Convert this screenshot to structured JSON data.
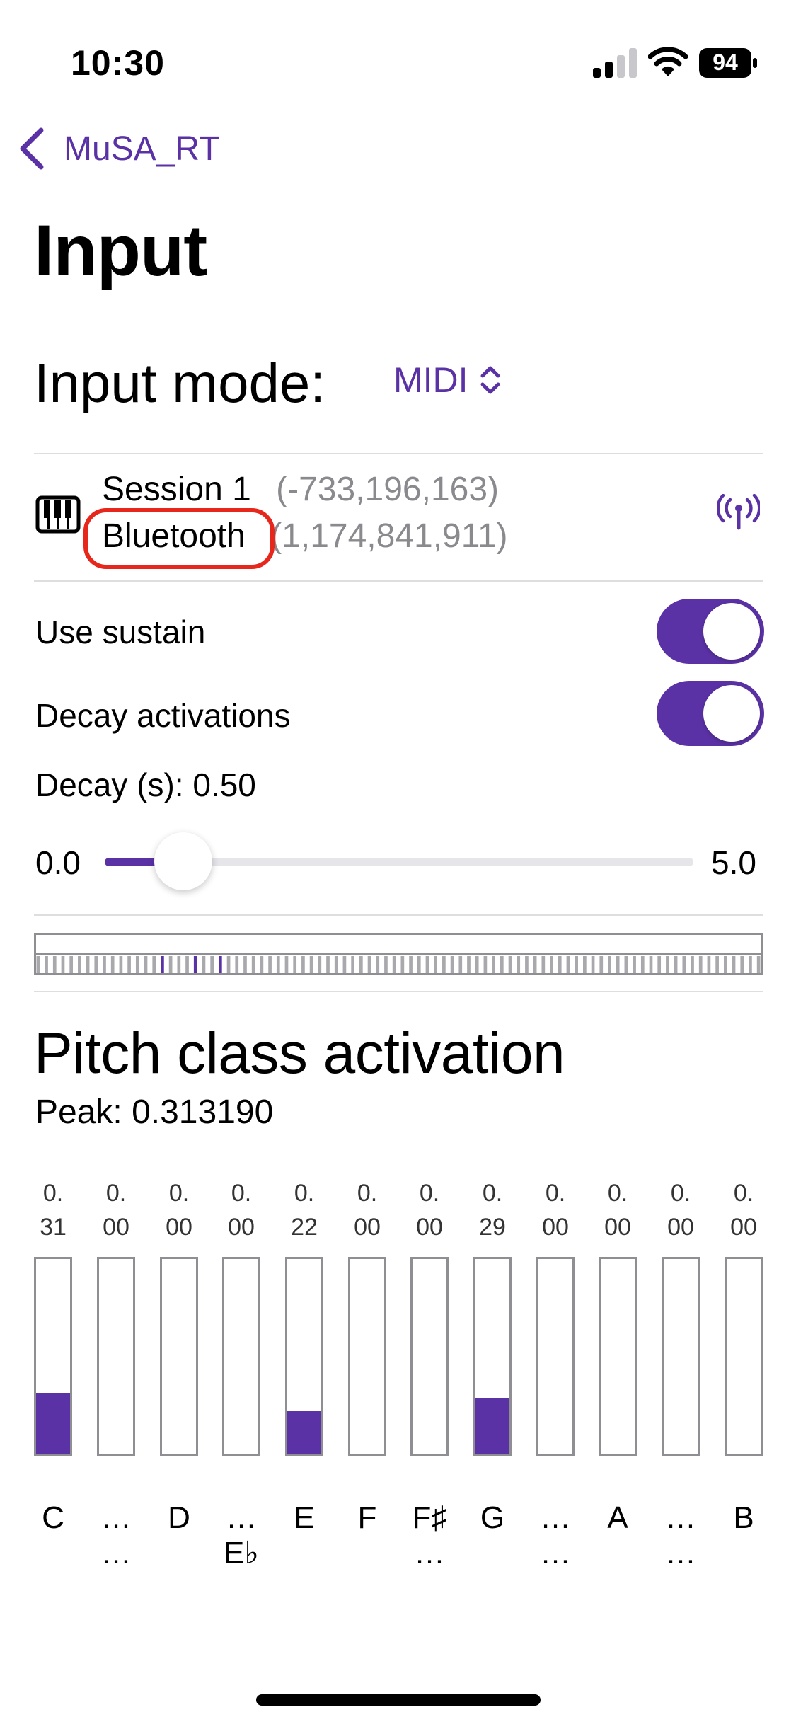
{
  "status_bar": {
    "time": "10:30",
    "battery": "94"
  },
  "nav": {
    "back_label": "MuSA_RT"
  },
  "page": {
    "title": "Input"
  },
  "input_mode": {
    "label": "Input mode:",
    "value": "MIDI"
  },
  "device": {
    "name": "Session 1",
    "name_id": "(-733,196,163)",
    "type": "Bluetooth",
    "type_id": "(1,174,841,911)"
  },
  "settings": {
    "use_sustain_label": "Use sustain",
    "use_sustain_on": true,
    "decay_activations_label": "Decay activations",
    "decay_activations_on": true,
    "decay_value_label": "Decay (s): 0.50",
    "decay_value": 0.5,
    "slider_min": "0.0",
    "slider_max": "5.0"
  },
  "pitch": {
    "title": "Pitch class activation",
    "peak_label": "Peak: 0.313190",
    "bars": [
      {
        "top": "0.",
        "bottom": "31",
        "value": 0.31,
        "note": "C",
        "note2": ""
      },
      {
        "top": "0.",
        "bottom": "00",
        "value": 0.0,
        "note": "…",
        "note2": "…"
      },
      {
        "top": "0.",
        "bottom": "00",
        "value": 0.0,
        "note": "D",
        "note2": ""
      },
      {
        "top": "0.",
        "bottom": "00",
        "value": 0.0,
        "note": "…",
        "note2": "E♭"
      },
      {
        "top": "0.",
        "bottom": "22",
        "value": 0.22,
        "note": "E",
        "note2": ""
      },
      {
        "top": "0.",
        "bottom": "00",
        "value": 0.0,
        "note": "F",
        "note2": ""
      },
      {
        "top": "0.",
        "bottom": "00",
        "value": 0.0,
        "note": "F♯",
        "note2": "…"
      },
      {
        "top": "0.",
        "bottom": "29",
        "value": 0.29,
        "note": "G",
        "note2": ""
      },
      {
        "top": "0.",
        "bottom": "00",
        "value": 0.0,
        "note": "…",
        "note2": "…"
      },
      {
        "top": "0.",
        "bottom": "00",
        "value": 0.0,
        "note": "A",
        "note2": ""
      },
      {
        "top": "0.",
        "bottom": "00",
        "value": 0.0,
        "note": "…",
        "note2": "…"
      },
      {
        "top": "0.",
        "bottom": "00",
        "value": 0.0,
        "note": "B",
        "note2": ""
      }
    ]
  },
  "colors": {
    "accent": "#5b32a6",
    "annotation": "#e8271c",
    "muted": "#8a8a8e"
  },
  "icons": [
    "chevron-left-icon",
    "chevron-up-down-icon",
    "piano-keyboard-icon",
    "antenna-radiowaves-icon",
    "cellular-signal-icon",
    "wifi-icon",
    "battery-icon"
  ]
}
